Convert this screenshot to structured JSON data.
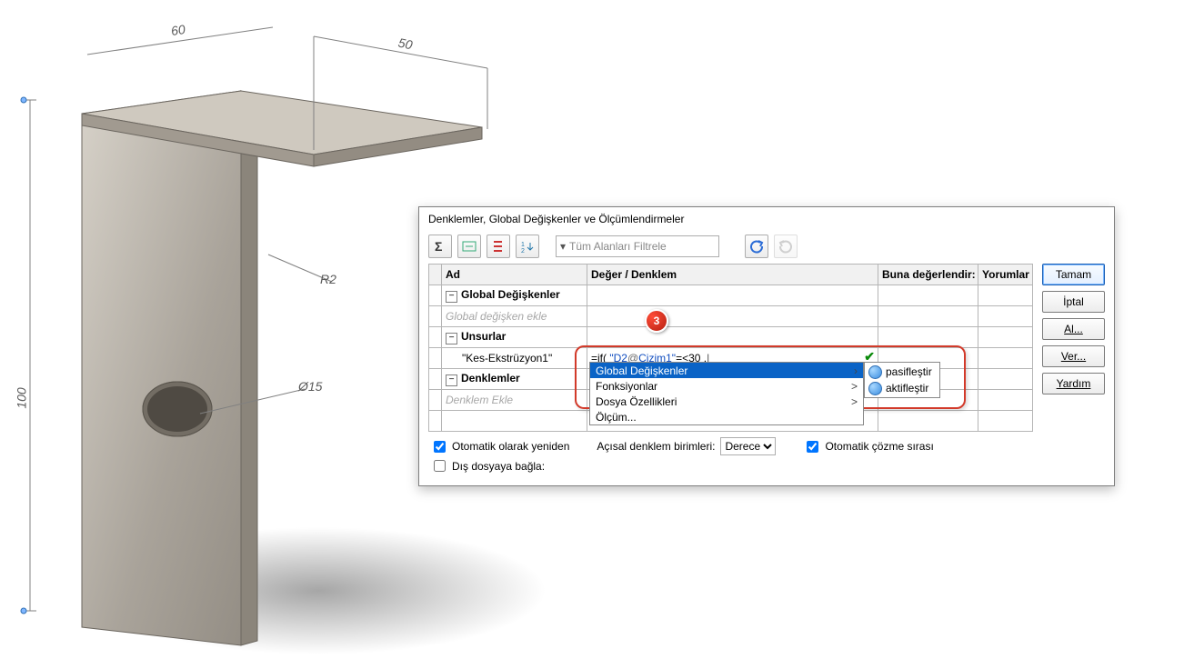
{
  "dimensions": {
    "width60": "60",
    "depth50": "50",
    "height100": "100",
    "radius": "R2",
    "hole": "Ø15"
  },
  "dialog": {
    "title": "Denklemler, Global Değişkenler ve Ölçümlendirmeler",
    "filter_placeholder": "Tüm Alanları Filtrele",
    "headers": {
      "name": "Ad",
      "value": "Değer / Denklem",
      "eval": "Buna değerlendir:",
      "comments": "Yorumlar"
    },
    "sections": {
      "globals_title": "Global Değişkenler",
      "globals_placeholder": "Global değişken ekle",
      "features_title": "Unsurlar",
      "feature_row_name": "\"Kes-Ekstrüzyon1\"",
      "equations_title": "Denklemler",
      "equations_placeholder": "Denklem Ekle"
    },
    "formula": {
      "raw_html": "=if( <span class='blue'>\"D2</span><span class='grey'>@</span><span class='blue'>Çizim1\"</span>=<30 ,|"
    },
    "dropdown": {
      "opt_globals": "Global Değişkenler",
      "opt_functions": "Fonksiyonlar",
      "opt_fileprops": "Dosya Özellikleri",
      "opt_measure": "Ölçüm..."
    },
    "submenu": {
      "deactivate": "pasifleştir",
      "activate": "aktifleştir"
    },
    "buttons": {
      "ok": "Tamam",
      "cancel": "İptal",
      "import": "Al...",
      "export": "Ver...",
      "help": "Yardım"
    },
    "footer": {
      "auto_rebuild": "Otomatik olarak yeniden",
      "angular_units_label": "Açısal denklem birimleri:",
      "angular_units_value": "Derece",
      "auto_solve": "Otomatik çözme sırası",
      "link_external": "Dış dosyaya bağla:"
    },
    "step_badge": "3"
  }
}
